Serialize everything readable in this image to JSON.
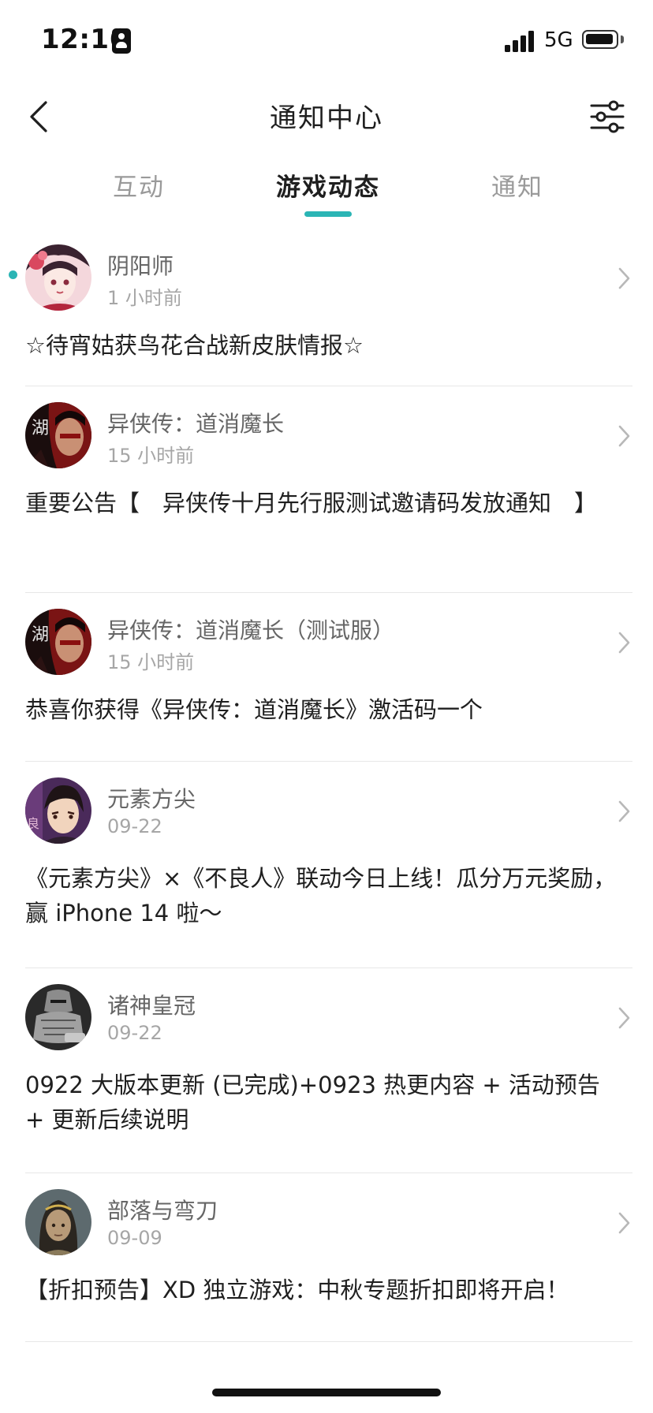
{
  "status_bar": {
    "time": "12:16",
    "network": "5G",
    "battery_level": 0.85
  },
  "header": {
    "title": "通知中心",
    "back_icon": "chevron-left-icon",
    "filter_icon": "sliders-icon"
  },
  "tabs": [
    {
      "label": "互动",
      "active": false
    },
    {
      "label": "游戏动态",
      "active": true
    },
    {
      "label": "通知",
      "active": false
    }
  ],
  "accent_color": "#2bb5b5",
  "notifications": [
    {
      "game": "阴阳师",
      "time": "1 小时前",
      "message": "☆待宵姑获鸟花合战新皮肤情报☆",
      "unread": true
    },
    {
      "game": "异侠传：道消魔长",
      "time": "15 小时前",
      "message": "重要公告【　异侠传十月先行服测试邀请码发放通知　】",
      "unread": false
    },
    {
      "game": "异侠传：道消魔长（测试服）",
      "time": "15 小时前",
      "message": "恭喜你获得《异侠传：道消魔长》激活码一个",
      "unread": false
    },
    {
      "game": "元素方尖",
      "time": "09-22",
      "message": "《元素方尖》×《不良人》联动今日上线！瓜分万元奖励，赢 iPhone 14 啦～",
      "unread": false
    },
    {
      "game": "诸神皇冠",
      "time": "09-22",
      "message": "0922 大版本更新 (已完成)+0923 热更内容 + 活动预告 + 更新后续说明",
      "unread": false
    },
    {
      "game": "部落与弯刀",
      "time": "09-09",
      "message": "【折扣预告】XD 独立游戏：中秋专题折扣即将开启！",
      "unread": false
    }
  ]
}
